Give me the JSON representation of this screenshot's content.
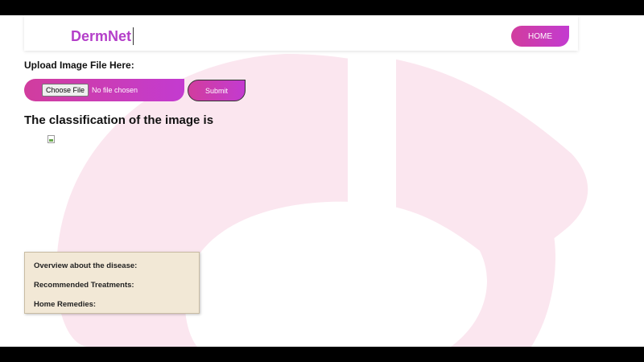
{
  "navbar": {
    "brand": "DermNet",
    "home_label": "HOME"
  },
  "upload": {
    "label": "Upload Image File Here:",
    "choose_file_label": "Choose File",
    "file_status": "No file chosen",
    "submit_label": "Submit"
  },
  "result": {
    "heading": "The classification of the image is"
  },
  "info": {
    "overview": "Overview about the disease:",
    "treatments": "Recommended Treatments:",
    "remedies": "Home Remedies:"
  },
  "colors": {
    "brand": "#b43fc9",
    "button_gradient_start": "#d13d9e",
    "button_gradient_end": "#c33bd0",
    "info_box_bg": "#f2e8d6",
    "background_logo": "#fbe6ef"
  },
  "icons": {
    "result_image": "broken-image-icon"
  }
}
